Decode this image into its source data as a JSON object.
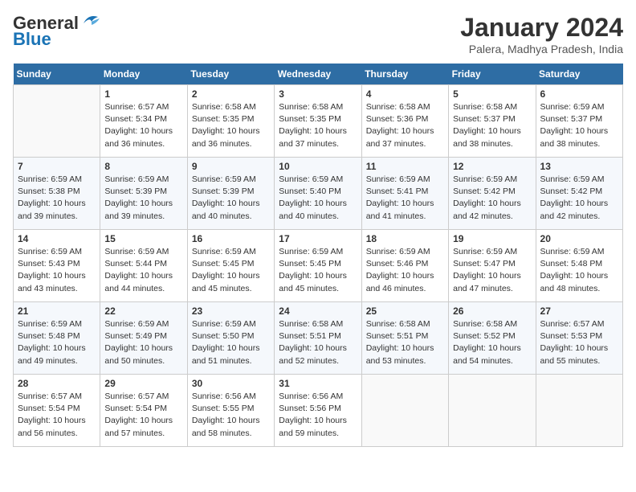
{
  "logo": {
    "line1": "General",
    "line2": "Blue"
  },
  "title": "January 2024",
  "subtitle": "Palera, Madhya Pradesh, India",
  "days_of_week": [
    "Sunday",
    "Monday",
    "Tuesday",
    "Wednesday",
    "Thursday",
    "Friday",
    "Saturday"
  ],
  "weeks": [
    [
      {
        "day": "",
        "empty": true
      },
      {
        "day": "1",
        "sunrise": "6:57 AM",
        "sunset": "5:34 PM",
        "daylight": "10 hours and 36 minutes."
      },
      {
        "day": "2",
        "sunrise": "6:58 AM",
        "sunset": "5:35 PM",
        "daylight": "10 hours and 36 minutes."
      },
      {
        "day": "3",
        "sunrise": "6:58 AM",
        "sunset": "5:35 PM",
        "daylight": "10 hours and 37 minutes."
      },
      {
        "day": "4",
        "sunrise": "6:58 AM",
        "sunset": "5:36 PM",
        "daylight": "10 hours and 37 minutes."
      },
      {
        "day": "5",
        "sunrise": "6:58 AM",
        "sunset": "5:37 PM",
        "daylight": "10 hours and 38 minutes."
      },
      {
        "day": "6",
        "sunrise": "6:59 AM",
        "sunset": "5:37 PM",
        "daylight": "10 hours and 38 minutes."
      }
    ],
    [
      {
        "day": "7",
        "sunrise": "6:59 AM",
        "sunset": "5:38 PM",
        "daylight": "10 hours and 39 minutes."
      },
      {
        "day": "8",
        "sunrise": "6:59 AM",
        "sunset": "5:39 PM",
        "daylight": "10 hours and 39 minutes."
      },
      {
        "day": "9",
        "sunrise": "6:59 AM",
        "sunset": "5:39 PM",
        "daylight": "10 hours and 40 minutes."
      },
      {
        "day": "10",
        "sunrise": "6:59 AM",
        "sunset": "5:40 PM",
        "daylight": "10 hours and 40 minutes."
      },
      {
        "day": "11",
        "sunrise": "6:59 AM",
        "sunset": "5:41 PM",
        "daylight": "10 hours and 41 minutes."
      },
      {
        "day": "12",
        "sunrise": "6:59 AM",
        "sunset": "5:42 PM",
        "daylight": "10 hours and 42 minutes."
      },
      {
        "day": "13",
        "sunrise": "6:59 AM",
        "sunset": "5:42 PM",
        "daylight": "10 hours and 42 minutes."
      }
    ],
    [
      {
        "day": "14",
        "sunrise": "6:59 AM",
        "sunset": "5:43 PM",
        "daylight": "10 hours and 43 minutes."
      },
      {
        "day": "15",
        "sunrise": "6:59 AM",
        "sunset": "5:44 PM",
        "daylight": "10 hours and 44 minutes."
      },
      {
        "day": "16",
        "sunrise": "6:59 AM",
        "sunset": "5:45 PM",
        "daylight": "10 hours and 45 minutes."
      },
      {
        "day": "17",
        "sunrise": "6:59 AM",
        "sunset": "5:45 PM",
        "daylight": "10 hours and 45 minutes."
      },
      {
        "day": "18",
        "sunrise": "6:59 AM",
        "sunset": "5:46 PM",
        "daylight": "10 hours and 46 minutes."
      },
      {
        "day": "19",
        "sunrise": "6:59 AM",
        "sunset": "5:47 PM",
        "daylight": "10 hours and 47 minutes."
      },
      {
        "day": "20",
        "sunrise": "6:59 AM",
        "sunset": "5:48 PM",
        "daylight": "10 hours and 48 minutes."
      }
    ],
    [
      {
        "day": "21",
        "sunrise": "6:59 AM",
        "sunset": "5:48 PM",
        "daylight": "10 hours and 49 minutes."
      },
      {
        "day": "22",
        "sunrise": "6:59 AM",
        "sunset": "5:49 PM",
        "daylight": "10 hours and 50 minutes."
      },
      {
        "day": "23",
        "sunrise": "6:59 AM",
        "sunset": "5:50 PM",
        "daylight": "10 hours and 51 minutes."
      },
      {
        "day": "24",
        "sunrise": "6:58 AM",
        "sunset": "5:51 PM",
        "daylight": "10 hours and 52 minutes."
      },
      {
        "day": "25",
        "sunrise": "6:58 AM",
        "sunset": "5:51 PM",
        "daylight": "10 hours and 53 minutes."
      },
      {
        "day": "26",
        "sunrise": "6:58 AM",
        "sunset": "5:52 PM",
        "daylight": "10 hours and 54 minutes."
      },
      {
        "day": "27",
        "sunrise": "6:57 AM",
        "sunset": "5:53 PM",
        "daylight": "10 hours and 55 minutes."
      }
    ],
    [
      {
        "day": "28",
        "sunrise": "6:57 AM",
        "sunset": "5:54 PM",
        "daylight": "10 hours and 56 minutes."
      },
      {
        "day": "29",
        "sunrise": "6:57 AM",
        "sunset": "5:54 PM",
        "daylight": "10 hours and 57 minutes."
      },
      {
        "day": "30",
        "sunrise": "6:56 AM",
        "sunset": "5:55 PM",
        "daylight": "10 hours and 58 minutes."
      },
      {
        "day": "31",
        "sunrise": "6:56 AM",
        "sunset": "5:56 PM",
        "daylight": "10 hours and 59 minutes."
      },
      {
        "day": "",
        "empty": true
      },
      {
        "day": "",
        "empty": true
      },
      {
        "day": "",
        "empty": true
      }
    ]
  ]
}
